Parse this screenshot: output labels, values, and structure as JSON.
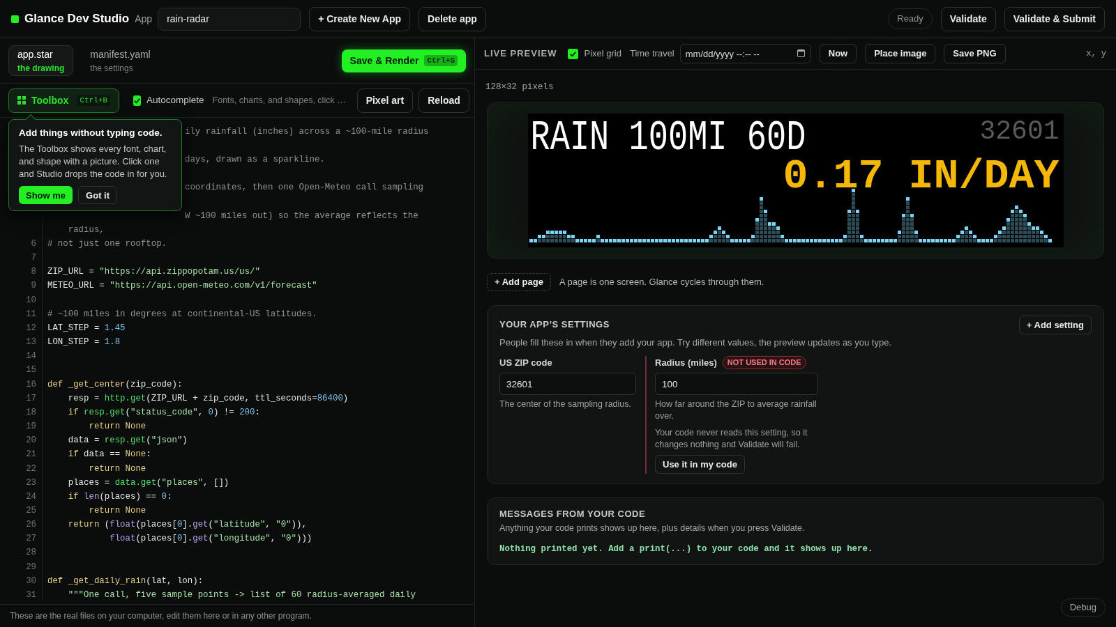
{
  "top_bar": {
    "brand": "Glance Dev Studio",
    "app_label": "App",
    "app_name": "rain-radar",
    "buttons": [
      "+ Create New App",
      "Delete app"
    ],
    "status": "Ready",
    "actions": [
      "Validate",
      "Validate & Submit"
    ]
  },
  "file_tabs": [
    {
      "name": "app.star",
      "subtitle": "the drawing",
      "selected": true
    },
    {
      "name": "manifest.yaml",
      "subtitle": "the settings",
      "selected": false
    }
  ],
  "save_button": {
    "label": "Save & Render",
    "shortcut": "Ctrl+S"
  },
  "toolbar": {
    "toolbox": {
      "label": "Toolbox",
      "shortcut": "Ctrl+B"
    },
    "autocomplete": {
      "label": "Autocomplete",
      "checked": true
    },
    "hint": "Fonts, charts, and shapes, click …",
    "buttons": [
      "Pixel art",
      "Reload"
    ]
  },
  "tooltip": {
    "title": "Add things without typing code.",
    "body": "The Toolbox shows every font, chart, and shape with a picture. Click one and Studio drops the code in for you.",
    "buttons": [
      {
        "label": "Show me",
        "kind": "primary"
      },
      {
        "label": "Got it",
        "kind": "secondary"
      }
    ]
  },
  "code_rows": [
    {
      "kind": "partial",
      "tokens": [
        {
          "t": "ily rainfall (inches) across a ~100-mile radius",
          "kind": "comment"
        }
      ]
    },
    {
      "kind": "covered"
    },
    {
      "kind": "partial",
      "tokens": [
        {
          "t": "days, drawn as a sparkline.",
          "kind": "comment"
        }
      ]
    },
    {
      "kind": "covered"
    },
    {
      "kind": "partial",
      "tokens": [
        {
          "t": "coordinates, then one Open-Meteo call sampling",
          "kind": "comment"
        }
      ]
    },
    {
      "kind": "covered"
    },
    {
      "kind": "partial",
      "tokens": [
        {
          "t": "W ~100 miles out) so the average reflects the",
          "kind": "comment"
        }
      ]
    },
    {
      "kind": "code",
      "tokens": [
        {
          "t": "    radius,",
          "kind": "comment"
        }
      ]
    },
    {
      "kind": "code",
      "number": "6",
      "tokens": [
        {
          "t": "# not just one rooftop.",
          "kind": "comment"
        }
      ]
    },
    {
      "kind": "code",
      "number": "7"
    },
    {
      "kind": "code",
      "number": "8",
      "tokens": [
        {
          "t": "ZIP_URL = ",
          "kind": "plain"
        },
        {
          "t": "\"https://api.zippopotam.us/us/\"",
          "kind": "string"
        }
      ]
    },
    {
      "kind": "code",
      "number": "9",
      "tokens": [
        {
          "t": "METEO_URL = ",
          "kind": "plain"
        },
        {
          "t": "\"https://api.open-meteo.com/v1/forecast\"",
          "kind": "string"
        }
      ]
    },
    {
      "kind": "code",
      "number": "10"
    },
    {
      "kind": "code",
      "number": "11",
      "tokens": [
        {
          "t": "# ~100 miles in degrees at continental-US latitudes.",
          "kind": "comment"
        }
      ]
    },
    {
      "kind": "code",
      "number": "12",
      "tokens": [
        {
          "t": "LAT_STEP = ",
          "kind": "plain"
        },
        {
          "t": "1.45",
          "kind": "number"
        }
      ]
    },
    {
      "kind": "code",
      "number": "13",
      "tokens": [
        {
          "t": "LON_STEP = ",
          "kind": "plain"
        },
        {
          "t": "1.8",
          "kind": "number"
        }
      ]
    },
    {
      "kind": "code",
      "number": "14"
    },
    {
      "kind": "code",
      "number": "15"
    },
    {
      "kind": "code",
      "number": "16",
      "tokens": [
        {
          "t": "def _get_center",
          "kind": "keyword"
        },
        {
          "t": "(zip_code):",
          "kind": "plain"
        }
      ]
    },
    {
      "kind": "code",
      "number": "17",
      "tokens": [
        {
          "t": "    resp = ",
          "kind": "plain"
        },
        {
          "t": "http.get",
          "kind": "call"
        },
        {
          "t": "(ZIP_URL + zip_code, ttl_seconds=",
          "kind": "plain"
        },
        {
          "t": "86400",
          "kind": "number"
        },
        {
          "t": ")",
          "kind": "plain"
        }
      ]
    },
    {
      "kind": "code",
      "number": "18",
      "tokens": [
        {
          "t": "    if ",
          "kind": "keyword"
        },
        {
          "t": "resp.get",
          "kind": "call"
        },
        {
          "t": "(",
          "kind": "plain"
        },
        {
          "t": "\"status_code\"",
          "kind": "string"
        },
        {
          "t": ", ",
          "kind": "plain"
        },
        {
          "t": "0",
          "kind": "number"
        },
        {
          "t": ") != ",
          "kind": "plain"
        },
        {
          "t": "200",
          "kind": "number"
        },
        {
          "t": ":",
          "kind": "plain"
        }
      ]
    },
    {
      "kind": "code",
      "number": "19",
      "tokens": [
        {
          "t": "        return None",
          "kind": "keyword"
        }
      ]
    },
    {
      "kind": "code",
      "number": "20",
      "tokens": [
        {
          "t": "    data = ",
          "kind": "plain"
        },
        {
          "t": "resp.get",
          "kind": "call"
        },
        {
          "t": "(",
          "kind": "plain"
        },
        {
          "t": "\"json\"",
          "kind": "string"
        },
        {
          "t": ")",
          "kind": "plain"
        }
      ]
    },
    {
      "kind": "code",
      "number": "21",
      "tokens": [
        {
          "t": "    if",
          "kind": "keyword"
        },
        {
          "t": " data == ",
          "kind": "plain"
        },
        {
          "t": "None",
          "kind": "keyword"
        },
        {
          "t": ":",
          "kind": "plain"
        }
      ]
    },
    {
      "kind": "code",
      "number": "22",
      "tokens": [
        {
          "t": "        return None",
          "kind": "keyword"
        }
      ]
    },
    {
      "kind": "code",
      "number": "23",
      "tokens": [
        {
          "t": "    places = ",
          "kind": "plain"
        },
        {
          "t": "data.get",
          "kind": "call"
        },
        {
          "t": "(",
          "kind": "plain"
        },
        {
          "t": "\"places\"",
          "kind": "string"
        },
        {
          "t": ", [])",
          "kind": "plain"
        }
      ]
    },
    {
      "kind": "code",
      "number": "24",
      "tokens": [
        {
          "t": "    if ",
          "kind": "keyword"
        },
        {
          "t": "len",
          "kind": "builtin"
        },
        {
          "t": "(places) == ",
          "kind": "plain"
        },
        {
          "t": "0",
          "kind": "number"
        },
        {
          "t": ":",
          "kind": "plain"
        }
      ]
    },
    {
      "kind": "code",
      "number": "25",
      "tokens": [
        {
          "t": "        return None",
          "kind": "keyword"
        }
      ]
    },
    {
      "kind": "code",
      "number": "26",
      "tokens": [
        {
          "t": "    return",
          "kind": "keyword"
        },
        {
          "t": " (",
          "kind": "plain"
        },
        {
          "t": "float",
          "kind": "builtin"
        },
        {
          "t": "(places[",
          "kind": "plain"
        },
        {
          "t": "0",
          "kind": "number"
        },
        {
          "t": "].",
          "kind": "plain"
        },
        {
          "t": "get",
          "kind": "builtin"
        },
        {
          "t": "(",
          "kind": "plain"
        },
        {
          "t": "\"latitude\"",
          "kind": "string"
        },
        {
          "t": ", ",
          "kind": "plain"
        },
        {
          "t": "\"0\"",
          "kind": "string"
        },
        {
          "t": ")),",
          "kind": "plain"
        }
      ]
    },
    {
      "kind": "code",
      "number": "27",
      "tokens": [
        {
          "t": "            float",
          "kind": "builtin"
        },
        {
          "t": "(places[",
          "kind": "plain"
        },
        {
          "t": "0",
          "kind": "number"
        },
        {
          "t": "].",
          "kind": "plain"
        },
        {
          "t": "get",
          "kind": "builtin"
        },
        {
          "t": "(",
          "kind": "plain"
        },
        {
          "t": "\"longitude\"",
          "kind": "string"
        },
        {
          "t": ", ",
          "kind": "plain"
        },
        {
          "t": "\"0\"",
          "kind": "string"
        },
        {
          "t": ")))",
          "kind": "plain"
        }
      ]
    },
    {
      "kind": "code",
      "number": "28"
    },
    {
      "kind": "code",
      "number": "29"
    },
    {
      "kind": "code",
      "number": "30",
      "tokens": [
        {
          "t": "def _get_daily_rain",
          "kind": "keyword"
        },
        {
          "t": "(lat, lon):",
          "kind": "plain"
        }
      ]
    },
    {
      "kind": "code",
      "number": "31",
      "tokens": [
        {
          "t": "    \"\"\"One call, five sample points -> list of 60 radius-averaged daily",
          "kind": "string"
        }
      ]
    }
  ],
  "footer": "These are the real files on your computer, edit them here or in any other program.",
  "preview": {
    "title": "LIVE PREVIEW",
    "pixel_grid": {
      "label": "Pixel grid",
      "checked": true
    },
    "time_travel": {
      "label": "Time travel",
      "placeholder": "mm/dd/yyyy --:-- --"
    },
    "buttons": [
      "Now",
      "Place image",
      "Save PNG"
    ],
    "cursor": "x, y",
    "size": "128×32 pixels",
    "display": {
      "headline": "RAIN 100MI 60D",
      "zip": "32601",
      "reading": "0.17 IN/DAY"
    }
  },
  "add_page": {
    "button": "+ Add page",
    "note": "A page is one screen. Glance cycles through them."
  },
  "settings": {
    "title": "YOUR APP’S SETTINGS",
    "add_button": "+ Add setting",
    "description": "People fill these in when they add your app. Try different values, the preview updates as you type.",
    "fields": [
      {
        "label": "US ZIP code",
        "value": "32601",
        "help": "The center of the sampling radius.",
        "used": true
      },
      {
        "label": "Radius (miles)",
        "value": "100",
        "help": "How far around the ZIP to average rainfall over.",
        "used": false,
        "badge": "NOT USED IN CODE",
        "warning": "Your code never reads this setting, so it changes nothing and Validate will fail.",
        "action": "Use it in my code"
      }
    ]
  },
  "messages": {
    "title": "MESSAGES FROM YOUR CODE",
    "description": "Anything your code prints shows up here, plus details when you press Validate.",
    "output": "Nothing printed yet. Add a print(...) to your code and it shows up here."
  },
  "debug_button": "Debug"
}
